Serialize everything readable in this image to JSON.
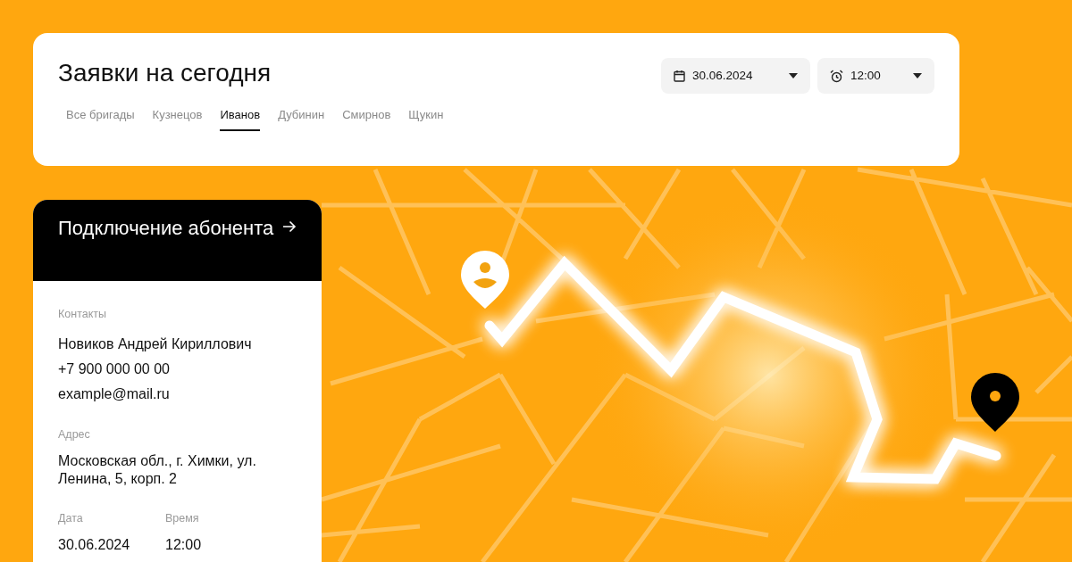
{
  "header": {
    "title": "Заявки на сегодня",
    "date_picker": {
      "value": "30.06.2024"
    },
    "time_picker": {
      "value": "12:00"
    },
    "tabs": [
      {
        "label": "Все бригады",
        "selected": false
      },
      {
        "label": "Кузнецов",
        "selected": false
      },
      {
        "label": "Иванов",
        "selected": true
      },
      {
        "label": "Дубинин",
        "selected": false
      },
      {
        "label": "Смирнов",
        "selected": false
      },
      {
        "label": "Щукин",
        "selected": false
      }
    ]
  },
  "order_card": {
    "title": "Подключение абонента",
    "sections": [
      {
        "label": "Контакты",
        "lines": [
          "Новиков Андрей Кириллович",
          "+7 900 000 00 00",
          "example@mail.ru"
        ]
      },
      {
        "label": "Адрес",
        "lines": [
          "Московская обл., г. Химки, ул. Ленина, 5, корп. 2"
        ]
      }
    ],
    "fields": [
      {
        "label": "Дата",
        "value": "30.06.2024"
      },
      {
        "label": "Время",
        "value": "12:00"
      }
    ]
  }
}
